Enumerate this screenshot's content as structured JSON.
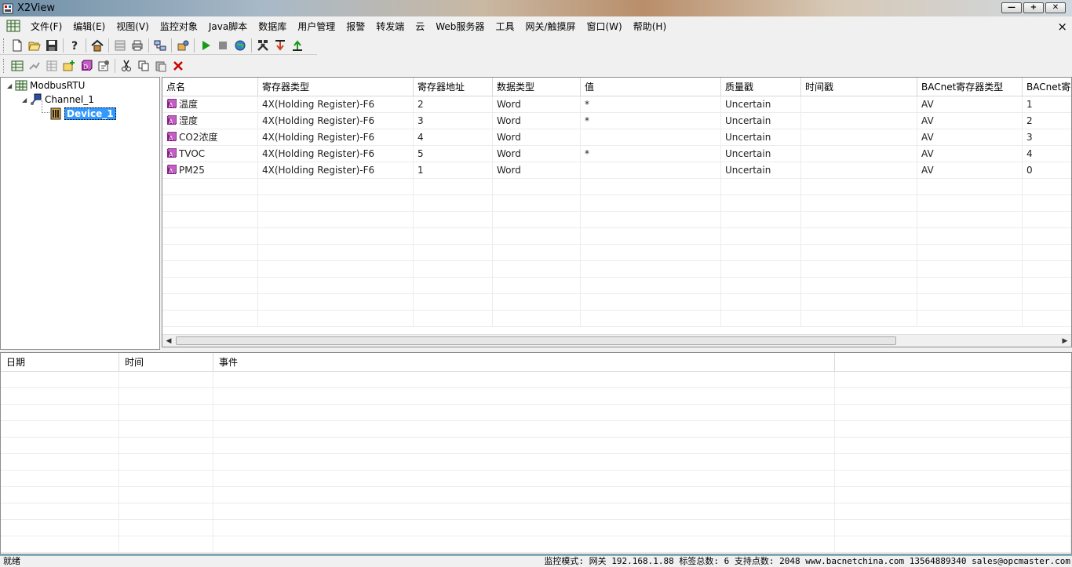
{
  "window": {
    "title": "X2View"
  },
  "menu": {
    "items": [
      "文件(F)",
      "编辑(E)",
      "视图(V)",
      "监控对象",
      "Java脚本",
      "数据库",
      "用户管理",
      "报警",
      "转发端",
      "云",
      "Web服务器",
      "工具",
      "网关/触摸屏",
      "窗口(W)",
      "帮助(H)"
    ],
    "close": "×"
  },
  "toolbar1": [
    "new-icon",
    "open-icon",
    "save-icon",
    "help-icon",
    "home-icon",
    "grid-icon",
    "print-icon",
    "network-icon",
    "plugin-icon",
    "run-icon",
    "stop-icon",
    "globe-icon",
    "tools-icon",
    "load-icon",
    "up-icon"
  ],
  "toolbar2": [
    "add-device-icon",
    "connect-icon",
    "table-icon",
    "add-point-icon",
    "cube-icon",
    "properties-icon",
    "cut-icon",
    "copy-icon",
    "paste-icon",
    "delete-icon"
  ],
  "tree": {
    "root": "ModbusRTU",
    "channel": "Channel_1",
    "device": "Device_1"
  },
  "grid": {
    "columns": [
      "点名",
      "寄存器类型",
      "寄存器地址",
      "数据类型",
      "值",
      "质量戳",
      "时间戳",
      "BACnet寄存器类型",
      "BACnet寄存"
    ],
    "rows": [
      [
        "温度",
        "4X(Holding Register)-F6",
        "2",
        "Word",
        "*",
        "Uncertain",
        "",
        "AV",
        "1"
      ],
      [
        "湿度",
        "4X(Holding Register)-F6",
        "3",
        "Word",
        "*",
        "Uncertain",
        "",
        "AV",
        "2"
      ],
      [
        "CO2浓度",
        "4X(Holding Register)-F6",
        "4",
        "Word",
        "",
        "Uncertain",
        "",
        "AV",
        "3"
      ],
      [
        "TVOC",
        "4X(Holding Register)-F6",
        "5",
        "Word",
        "*",
        "Uncertain",
        "",
        "AV",
        "4"
      ],
      [
        "PM25",
        "4X(Holding Register)-F6",
        "1",
        "Word",
        "",
        "Uncertain",
        "",
        "AV",
        "0"
      ]
    ]
  },
  "log": {
    "columns": [
      "日期",
      "时间",
      "事件"
    ]
  },
  "status": {
    "left": "就绪",
    "right": "监控模式: 网关 192.168.1.88 标签总数: 6    支持点数: 2048  www.bacnetchina.com 13564889340 sales@opcmaster.com"
  },
  "colors": {
    "selection": "#3399ff",
    "point_icon": "#8b1a8b",
    "statusbar_border": "#7fb0c6"
  }
}
